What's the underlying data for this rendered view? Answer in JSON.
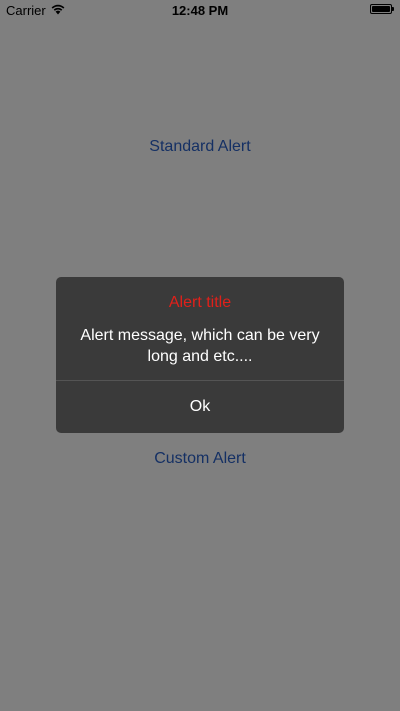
{
  "status_bar": {
    "carrier": "Carrier",
    "time": "12:48 PM",
    "wifi_icon": "wifi-icon",
    "battery_icon": "battery-icon"
  },
  "main": {
    "standard_alert_label": "Standard Alert",
    "custom_alert_label": "Custom Alert"
  },
  "alert": {
    "title": "Alert title",
    "message": "Alert message, which can be very long and etc....",
    "ok_label": "Ok"
  },
  "colors": {
    "link": "#2a61c8",
    "alert_background": "#3a3a3a",
    "alert_title": "#e0201a",
    "overlay": "rgba(0,0,0,0.5)"
  }
}
